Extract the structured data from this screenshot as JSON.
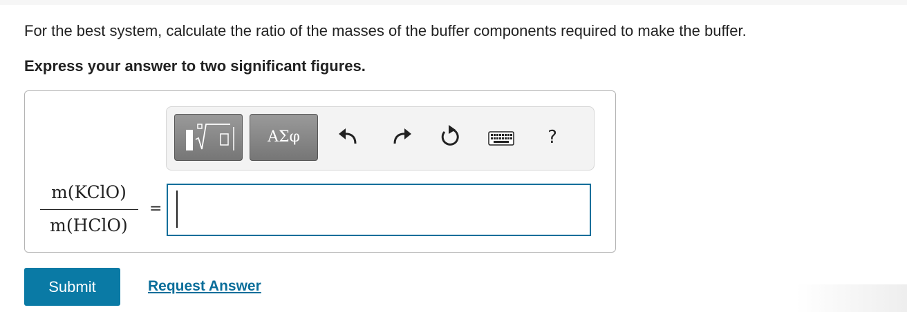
{
  "question": {
    "text": "For the best system, calculate the ratio of the masses of the buffer components required to make the buffer.",
    "instruction": "Express your answer to two significant figures."
  },
  "toolbar": {
    "template_button_icon": "fraction-root-template-icon",
    "symbols_label": "ΑΣφ",
    "undo_icon": "undo-icon",
    "redo_icon": "redo-icon",
    "reset_icon": "reset-icon",
    "keyboard_icon": "keyboard-icon",
    "help_label": "?"
  },
  "equation": {
    "numerator": "m(KClO)",
    "denominator": "m(HClO)",
    "equals": "="
  },
  "answer": {
    "value": ""
  },
  "actions": {
    "submit_label": "Submit",
    "request_answer_label": "Request Answer"
  },
  "colors": {
    "accent": "#0a7aa5",
    "link": "#0a6e9a",
    "toolbar_button": "#808080"
  }
}
